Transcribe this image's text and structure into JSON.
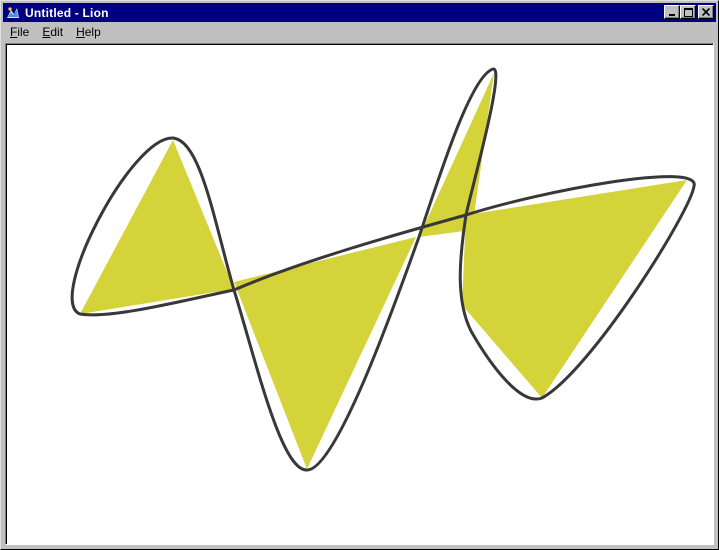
{
  "window": {
    "title": "Untitled - Lion",
    "app_icon": "lion-app-icon",
    "controls": {
      "minimize_icon": "minimize-icon",
      "maximize_icon": "maximize-icon",
      "close_icon": "close-icon"
    }
  },
  "menu": {
    "items": [
      {
        "mnemonic": "F",
        "rest": "ile"
      },
      {
        "mnemonic": "E",
        "rest": "dit"
      },
      {
        "mnemonic": "H",
        "rest": "elp"
      }
    ]
  },
  "drawing": {
    "fill_color": "#d4d33a",
    "stroke_color": "#383838",
    "background_color": "#ffffff"
  }
}
